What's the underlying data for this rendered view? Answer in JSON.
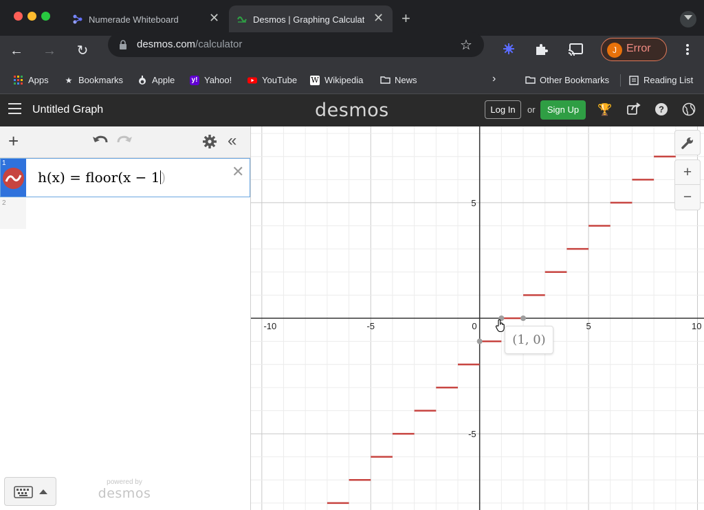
{
  "browser": {
    "tabs": [
      {
        "title": "Numerade Whiteboard",
        "active": false
      },
      {
        "title": "Desmos | Graphing Calculator",
        "active": true
      }
    ],
    "url_host": "desmos.com",
    "url_path": "/calculator",
    "profile": {
      "initial": "J",
      "status": "Error"
    },
    "bookmarks": [
      "Apps",
      "Bookmarks",
      "Apple",
      "Yahoo!",
      "YouTube",
      "Wikipedia",
      "News"
    ],
    "other_bookmarks": "Other Bookmarks",
    "reading_list": "Reading List"
  },
  "desmos": {
    "graph_title": "Untitled Graph",
    "logo": "desmos",
    "login_label": "Log In",
    "or_label": "or",
    "signup_label": "Sign Up",
    "expressions": [
      {
        "number": "1",
        "latex_text": "h(x) = floor(x − 1",
        "closing_paren": ")",
        "color": "#c74440"
      },
      {
        "number": "2",
        "latex_text": ""
      }
    ],
    "powered_by": "powered by",
    "powered_logo": "desmos",
    "tooltip": "(1, 0)"
  },
  "chart_data": {
    "type": "line",
    "function": "h(x) = floor(x - 1)",
    "xlim": [
      -10.5,
      10.3
    ],
    "ylim": [
      -8.3,
      8.3
    ],
    "x_ticks": [
      -10,
      -5,
      0,
      5,
      10
    ],
    "y_ticks": [
      -5,
      5
    ],
    "grid": true,
    "series": [
      {
        "name": "h(x) = floor(x - 1)",
        "color": "#c74440",
        "segments": [
          {
            "x0": -7,
            "x1": -6,
            "y": -8
          },
          {
            "x0": -6,
            "x1": -5,
            "y": -7
          },
          {
            "x0": -5,
            "x1": -4,
            "y": -6
          },
          {
            "x0": -4,
            "x1": -3,
            "y": -5
          },
          {
            "x0": -3,
            "x1": -2,
            "y": -4
          },
          {
            "x0": -2,
            "x1": -1,
            "y": -3
          },
          {
            "x0": -1,
            "x1": 0,
            "y": -2
          },
          {
            "x0": 0,
            "x1": 1,
            "y": -1
          },
          {
            "x0": 1,
            "x1": 2,
            "y": 0
          },
          {
            "x0": 2,
            "x1": 3,
            "y": 1
          },
          {
            "x0": 3,
            "x1": 4,
            "y": 2
          },
          {
            "x0": 4,
            "x1": 5,
            "y": 3
          },
          {
            "x0": 5,
            "x1": 6,
            "y": 4
          },
          {
            "x0": 6,
            "x1": 7,
            "y": 5
          },
          {
            "x0": 7,
            "x1": 8,
            "y": 6
          },
          {
            "x0": 8,
            "x1": 9,
            "y": 7
          },
          {
            "x0": 9,
            "x1": 10,
            "y": 8
          }
        ]
      }
    ],
    "points": [
      {
        "x": 0,
        "y": -1
      },
      {
        "x": 1,
        "y": 0
      },
      {
        "x": 2,
        "y": 0
      }
    ]
  }
}
